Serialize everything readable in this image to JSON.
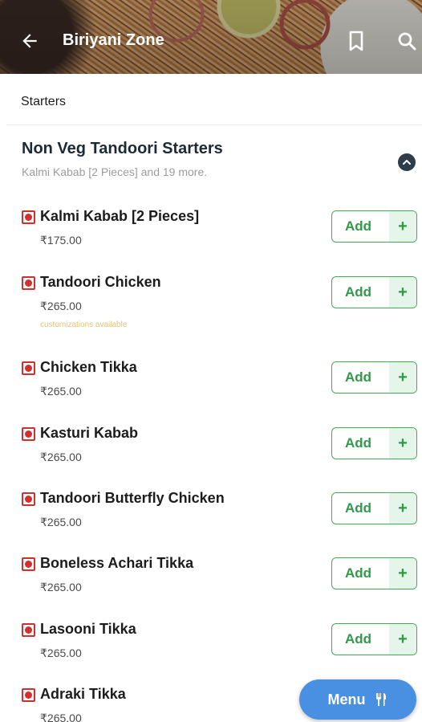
{
  "header": {
    "title": "Biriyani Zone",
    "icons": [
      "back-arrow-icon",
      "bookmark-icon",
      "search-icon"
    ]
  },
  "category": {
    "label": "Starters"
  },
  "section": {
    "title": "Non Veg Tandoori Starters",
    "subtitle": "Kalmi Kabab [2 Pieces] and 19 more.",
    "collapse_icon": "chevron-up-icon"
  },
  "items": [
    {
      "name": "Kalmi Kabab [2 Pieces]",
      "price": "₹175.00",
      "note": ""
    },
    {
      "name": "Tandoori Chicken",
      "price": "₹265.00",
      "note": "customizations available"
    },
    {
      "name": "Chicken Tikka",
      "price": "₹265.00",
      "note": ""
    },
    {
      "name": "Kasturi Kabab",
      "price": "₹265.00",
      "note": ""
    },
    {
      "name": "Tandoori Butterfly Chicken",
      "price": "₹265.00",
      "note": ""
    },
    {
      "name": "Boneless Achari Tikka",
      "price": "₹265.00",
      "note": ""
    },
    {
      "name": "Lasooni Tikka",
      "price": "₹265.00",
      "note": ""
    },
    {
      "name": "Adraki Tikka",
      "price": "₹265.00",
      "note": ""
    }
  ],
  "add_button": {
    "label": "Add",
    "plus": "+"
  },
  "menu_button": {
    "label": "Menu",
    "icon": "fork-knife-icon"
  },
  "colors": {
    "accent_green": "#2e9b47",
    "nonveg_red": "#d32f2f",
    "menu_blue": "#4a90e2",
    "note_yellow": "#e0c275"
  }
}
